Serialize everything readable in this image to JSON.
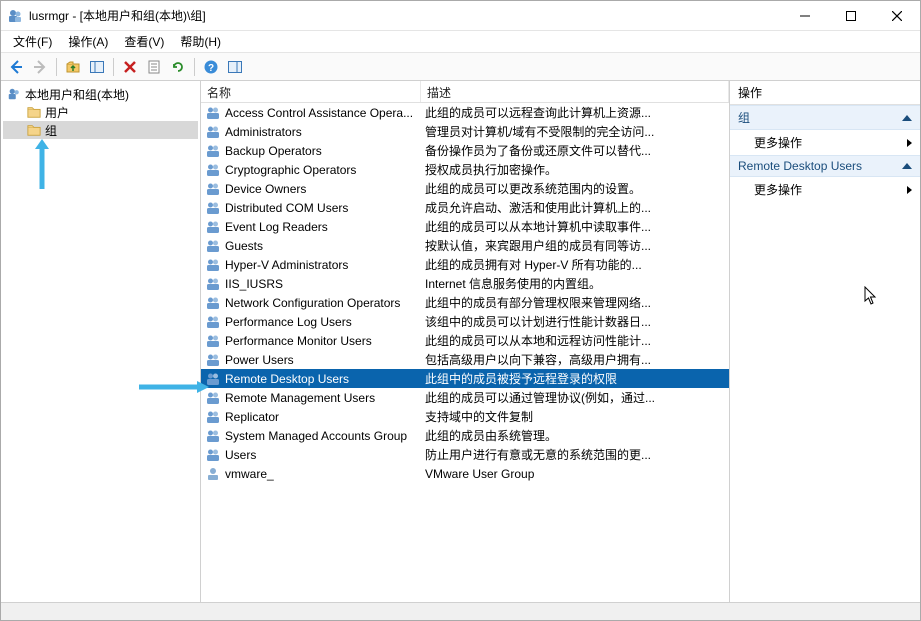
{
  "title": "lusrmgr - [本地用户和组(本地)\\组]",
  "menubar": {
    "file": "文件(F)",
    "action": "操作(A)",
    "view": "查看(V)",
    "help": "帮助(H)"
  },
  "tree": {
    "root": "本地用户和组(本地)",
    "users": "用户",
    "groups": "组"
  },
  "columns": {
    "name": "名称",
    "description": "描述"
  },
  "groups": [
    {
      "name": "Access Control Assistance Opera...",
      "desc": "此组的成员可以远程查询此计算机上资源..."
    },
    {
      "name": "Administrators",
      "desc": "管理员对计算机/域有不受限制的完全访问..."
    },
    {
      "name": "Backup Operators",
      "desc": "备份操作员为了备份或还原文件可以替代..."
    },
    {
      "name": "Cryptographic Operators",
      "desc": "授权成员执行加密操作。"
    },
    {
      "name": "Device Owners",
      "desc": "此组的成员可以更改系统范围内的设置。"
    },
    {
      "name": "Distributed COM Users",
      "desc": "成员允许启动、激活和使用此计算机上的..."
    },
    {
      "name": "Event Log Readers",
      "desc": "此组的成员可以从本地计算机中读取事件..."
    },
    {
      "name": "Guests",
      "desc": "按默认值，来宾跟用户组的成员有同等访..."
    },
    {
      "name": "Hyper-V Administrators",
      "desc": "此组的成员拥有对 Hyper-V 所有功能的..."
    },
    {
      "name": "IIS_IUSRS",
      "desc": "Internet 信息服务使用的内置组。"
    },
    {
      "name": "Network Configuration Operators",
      "desc": "此组中的成员有部分管理权限来管理网络..."
    },
    {
      "name": "Performance Log Users",
      "desc": "该组中的成员可以计划进行性能计数器日..."
    },
    {
      "name": "Performance Monitor Users",
      "desc": "此组的成员可以从本地和远程访问性能计..."
    },
    {
      "name": "Power Users",
      "desc": "包括高级用户以向下兼容，高级用户拥有..."
    },
    {
      "name": "Remote Desktop Users",
      "desc": "此组中的成员被授予远程登录的权限",
      "selected": true
    },
    {
      "name": "Remote Management Users",
      "desc": "此组的成员可以通过管理协议(例如，通过..."
    },
    {
      "name": "Replicator",
      "desc": "支持域中的文件复制"
    },
    {
      "name": "System Managed Accounts Group",
      "desc": "此组的成员由系统管理。"
    },
    {
      "name": "Users",
      "desc": "防止用户进行有意或无意的系统范围的更..."
    },
    {
      "name": "  vmware_",
      "desc": "VMware User Group",
      "alt_icon": true
    }
  ],
  "actions": {
    "header": "操作",
    "section1": "组",
    "more1": "更多操作",
    "section2": "Remote Desktop Users",
    "more2": "更多操作"
  }
}
